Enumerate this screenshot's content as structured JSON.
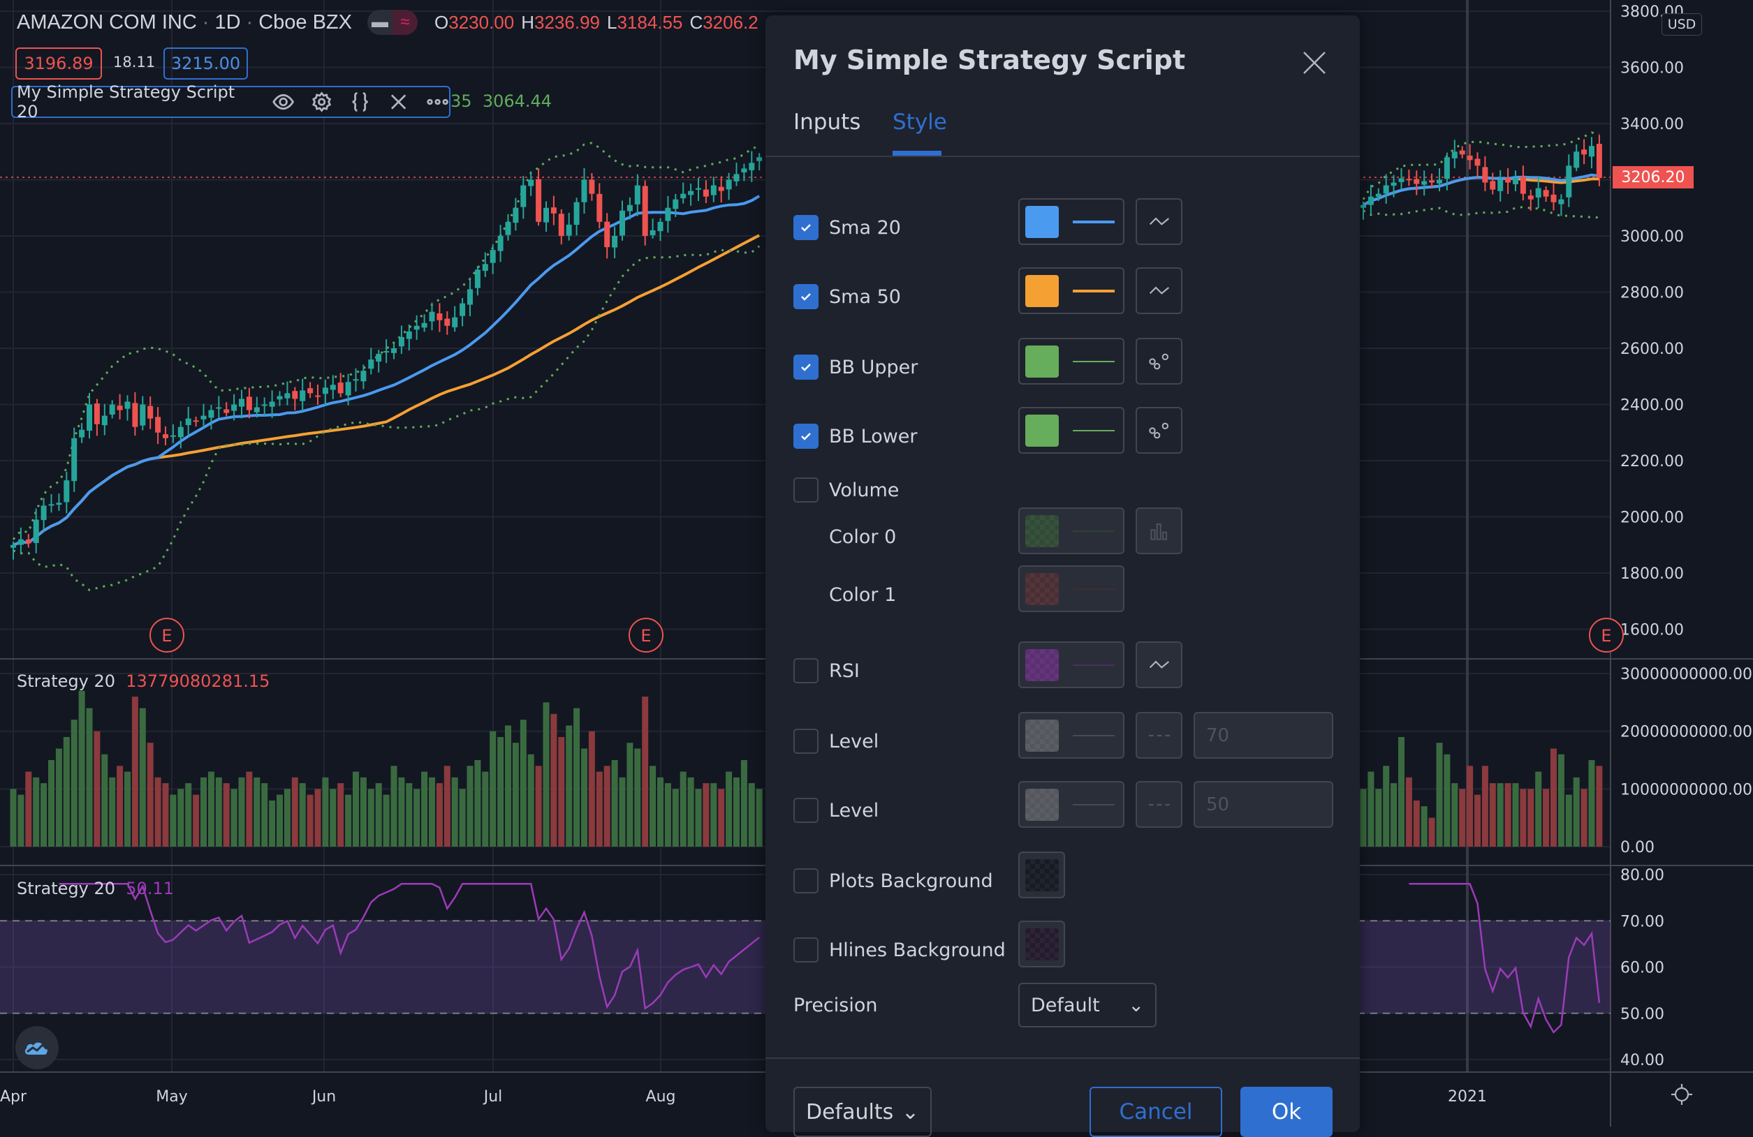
{
  "header": {
    "symbol": "AMAZON COM INC",
    "interval": "1D",
    "exchange": "Cboe BZX",
    "sep": "·",
    "ohlc": [
      {
        "k": "O",
        "v": "3230.00"
      },
      {
        "k": "H",
        "v": "3236.99"
      },
      {
        "k": "L",
        "v": "3184.55"
      },
      {
        "k": "C",
        "v": "3206.2"
      }
    ],
    "bid": "3196.89",
    "spread": "18.11",
    "ask": "3215.00"
  },
  "legend": {
    "name": "My Simple Strategy Script 20",
    "values_partial": "35",
    "value": "3064.44"
  },
  "volume_pane": {
    "name": "Strategy 20",
    "value": "13779080281.15"
  },
  "rsi_pane": {
    "name": "Strategy 20",
    "value": "50.11"
  },
  "price_axis": {
    "labels": [
      "3800.00",
      "3600.00",
      "3400.00",
      "3200.00",
      "3000.00",
      "2800.00",
      "2600.00",
      "2400.00",
      "2200.00",
      "2000.00",
      "1800.00",
      "1600.00"
    ],
    "currency": "USD",
    "last_price": "3206.20"
  },
  "volume_axis": {
    "labels": [
      "30000000000.00",
      "20000000000.00",
      "10000000000.00",
      "0.00"
    ]
  },
  "rsi_axis": {
    "labels": [
      "80.00",
      "70.00",
      "60.00",
      "50.00",
      "40.00"
    ]
  },
  "time_axis": {
    "labels": [
      "Apr",
      "May",
      "Jun",
      "Jul",
      "Aug",
      "2021"
    ]
  },
  "earnings_marker": "E",
  "colors": {
    "up": "#26a69a",
    "down": "#ef5350",
    "sma20": "#4a9af0",
    "sma50": "#f5a033",
    "bb": "#5fae5a",
    "rsi": "#9c3bb8",
    "accent": "#2f6fd0"
  },
  "series_left": {
    "closes": [
      1900,
      1920,
      1906,
      1990,
      2040,
      2045,
      2050,
      2130,
      2280,
      2310,
      2400,
      2330,
      2360,
      2400,
      2380,
      2410,
      2320,
      2400,
      2350,
      2300,
      2280,
      2290,
      2320,
      2350,
      2340,
      2360,
      2380,
      2390,
      2370,
      2400,
      2420,
      2380,
      2390,
      2400,
      2410,
      2430,
      2440,
      2420,
      2450,
      2440,
      2430,
      2460,
      2470,
      2440,
      2480,
      2490,
      2520,
      2560,
      2580,
      2590,
      2600,
      2640,
      2660,
      2680,
      2690,
      2730,
      2700,
      2680,
      2710,
      2760,
      2810,
      2880,
      2900,
      2950,
      3000,
      3050,
      3100,
      3180,
      3200,
      3050,
      3100,
      3080,
      3000,
      3040,
      3120,
      3200,
      3150,
      3050,
      2960,
      3000,
      3090,
      3110,
      3180,
      3000,
      3020,
      3050,
      3100,
      3130,
      3150,
      3160,
      3170,
      3140,
      3180,
      3160,
      3200,
      3220,
      3240,
      3260,
      3280
    ],
    "volumes": [
      10000000000.0,
      9000000000.0,
      13000000000.0,
      12000000000.0,
      11000000000.0,
      15000000000.0,
      17000000000.0,
      19000000000.0,
      22000000000.0,
      27000000000.0,
      24000000000.0,
      20000000000.0,
      16000000000.0,
      12000000000.0,
      14000000000.0,
      13000000000.0,
      26000000000.0,
      24000000000.0,
      18000000000.0,
      12000000000.0,
      11000000000.0,
      9000000000.0,
      10000000000.0,
      11000000000.0,
      9000000000.0,
      12000000000.0,
      13000000000.0,
      12000000000.0,
      11000000000.0,
      10000000000.0,
      12000000000.0,
      13000000000.0,
      12000000000.0,
      11000000000.0,
      8000000000.0,
      9000000000.0,
      10000000000.0,
      12000000000.0,
      11000000000.0,
      9000000000.0,
      10000000000.0,
      12000000000.0,
      10000000000.0,
      11000000000.0,
      9000000000.0,
      13000000000.0,
      12000000000.0,
      10000000000.0,
      11000000000.0,
      9000000000.0,
      14000000000.0,
      12000000000.0,
      11000000000.0,
      10000000000.0,
      13000000000.0,
      12000000000.0,
      11000000000.0,
      14000000000.0,
      12000000000.0,
      10000000000.0,
      14000000000.0,
      15000000000.0,
      13000000000.0,
      20000000000.0,
      19000000000.0,
      21000000000.0,
      18000000000.0,
      22000000000.0,
      16000000000.0,
      14000000000.0,
      25000000000.0,
      23000000000.0,
      19000000000.0,
      21000000000.0,
      24000000000.0,
      17000000000.0,
      20000000000.0,
      13000000000.0,
      14000000000.0,
      15000000000.0,
      12000000000.0,
      18000000000.0,
      17000000000.0,
      26000000000.0,
      14000000000.0,
      12000000000.0,
      11000000000.0,
      10000000000.0,
      13000000000.0,
      12000000000.0,
      10000000000.0,
      11000000000.0,
      11000000000.0,
      10000000000.0,
      13000000000.0,
      12000000000.0,
      15000000000.0,
      11000000000.0,
      10000000000.0
    ]
  },
  "series_right": {
    "closes": [
      3110,
      3140,
      3150,
      3180,
      3190,
      3205,
      3200,
      3185,
      3195,
      3190,
      3200,
      3280,
      3300,
      3290,
      3270,
      3250,
      3190,
      3165,
      3200,
      3190,
      3205,
      3150,
      3130,
      3170,
      3140,
      3120,
      3130,
      3250,
      3300,
      3290,
      3320,
      3206
    ],
    "volumes": [
      10000000000.0,
      13000000000.0,
      10000000000.0,
      14000000000.0,
      11000000000.0,
      19000000000.0,
      12000000000.0,
      8000000000.0,
      7000000000.0,
      5000000000.0,
      18000000000.0,
      16000000000.0,
      11000000000.0,
      10000000000.0,
      14000000000.0,
      9000000000.0,
      14000000000.0,
      11000000000.0,
      11000000000.0,
      11000000000.0,
      11000000000.0,
      10000000000.0,
      10000000000.0,
      13000000000.0,
      10000000000.0,
      17000000000.0,
      16000000000.0,
      9000000000.0,
      12000000000.0,
      10000000000.0,
      15000000000.0,
      14000000000.0
    ]
  },
  "dialog": {
    "title": "My Simple Strategy Script",
    "tabs": [
      {
        "label": "Inputs",
        "active": false
      },
      {
        "label": "Style",
        "active": true
      }
    ],
    "rows": [
      {
        "label": "Sma 20",
        "checked": true,
        "color": "#4a9af0",
        "style": "line"
      },
      {
        "label": "Sma 50",
        "checked": true,
        "color": "#f5a033",
        "style": "line"
      },
      {
        "label": "BB Upper",
        "checked": true,
        "color": "#66ad5c",
        "style": "circles"
      },
      {
        "label": "BB Lower",
        "checked": true,
        "color": "#66ad5c",
        "style": "circles"
      },
      {
        "label": "Volume",
        "checked": false
      },
      {
        "label": "Color 0",
        "color": "#2f4a35",
        "style": "columns"
      },
      {
        "label": "Color 1",
        "color": "#4a2e33"
      },
      {
        "label": "RSI",
        "checked": false,
        "color": "#5c2e72",
        "style": "line"
      },
      {
        "label": "Level",
        "checked": false,
        "color": "#55575e",
        "style": "dashed",
        "value": "70"
      },
      {
        "label": "Level",
        "checked": false,
        "color": "#55575e",
        "style": "dashed",
        "value": "50"
      },
      {
        "label": "Plots Background",
        "checked": false
      },
      {
        "label": "Hlines Background",
        "checked": false
      }
    ],
    "precision": {
      "label": "Precision",
      "value": "Default"
    },
    "defaults": "Defaults",
    "cancel": "Cancel",
    "ok": "Ok"
  }
}
